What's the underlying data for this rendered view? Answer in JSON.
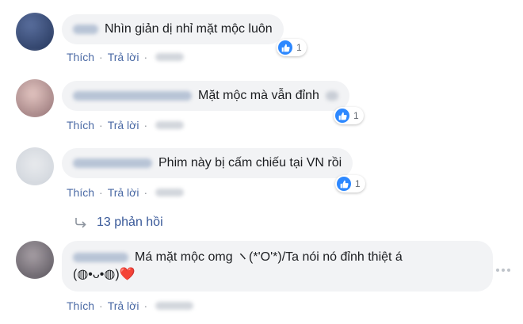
{
  "comments": [
    {
      "text": "Nhìn giản dị nhỉ mặt mộc luôn",
      "reaction_count": "1",
      "actions": {
        "like": "Thích",
        "reply": "Trả lời"
      }
    },
    {
      "text": "Mặt mộc mà vẫn đỉnh",
      "reaction_count": "1",
      "actions": {
        "like": "Thích",
        "reply": "Trả lời"
      }
    },
    {
      "text": "Phim này bị cấm chiếu tại VN rồi",
      "reaction_count": "1",
      "actions": {
        "like": "Thích",
        "reply": "Trả lời"
      }
    },
    {
      "text_line1": "Má mặt mộc omg ヽ(*'O'*)/Ta nói nó đỉnh thiệt á",
      "text_line2": "(◍•ᴗ•◍)❤️",
      "actions": {
        "like": "Thích",
        "reply": "Trả lời"
      }
    }
  ],
  "replies": {
    "label": "13 phản hồi"
  },
  "colors": {
    "bubble": "#f2f3f5",
    "link": "#4b6aa5",
    "like_badge": "#2d88ff",
    "heart": "#e0245e"
  },
  "icons": {
    "reaction": "like-thumb-icon",
    "replies": "reply-arrow-icon",
    "more": "more-options-icon"
  }
}
